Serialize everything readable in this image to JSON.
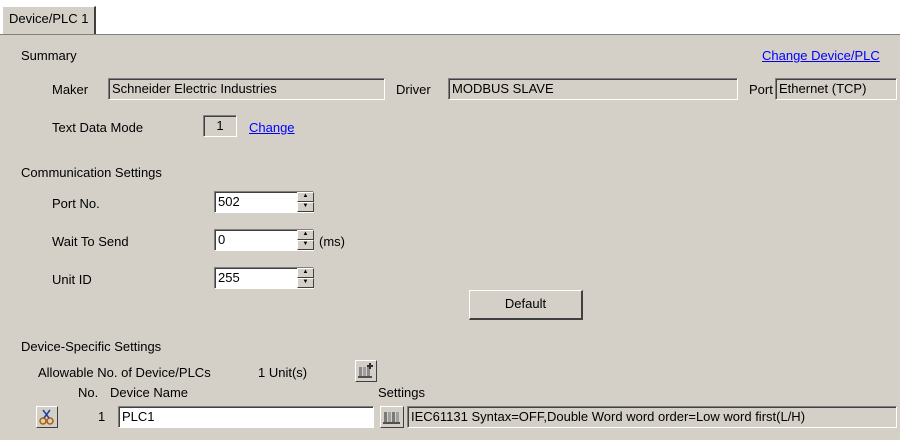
{
  "tab": {
    "label": "Device/PLC 1"
  },
  "summary": {
    "heading": "Summary",
    "change_device_link": "Change Device/PLC",
    "maker_label": "Maker",
    "maker_value": "Schneider Electric Industries",
    "driver_label": "Driver",
    "driver_value": "MODBUS SLAVE",
    "port_label": "Port",
    "port_value": "Ethernet (TCP)",
    "text_mode_label": "Text Data Mode",
    "text_mode_value": "1",
    "text_mode_change": "Change"
  },
  "comm": {
    "heading": "Communication Settings",
    "port_no_label": "Port No.",
    "port_no_value": "502",
    "wait_label": "Wait To Send",
    "wait_value": "0",
    "wait_unit": "(ms)",
    "unit_id_label": "Unit ID",
    "unit_id_value": "255",
    "default_button": "Default"
  },
  "device": {
    "heading": "Device-Specific Settings",
    "allowable_label": "Allowable No. of Device/PLCs",
    "allowable_value": "1 Unit(s)",
    "col_no": "No.",
    "col_name": "Device Name",
    "col_settings": "Settings",
    "rows": [
      {
        "no": "1",
        "name": "PLC1",
        "settings": "IEC61131 Syntax=OFF,Double Word word order=Low word first(L/H)"
      }
    ]
  }
}
